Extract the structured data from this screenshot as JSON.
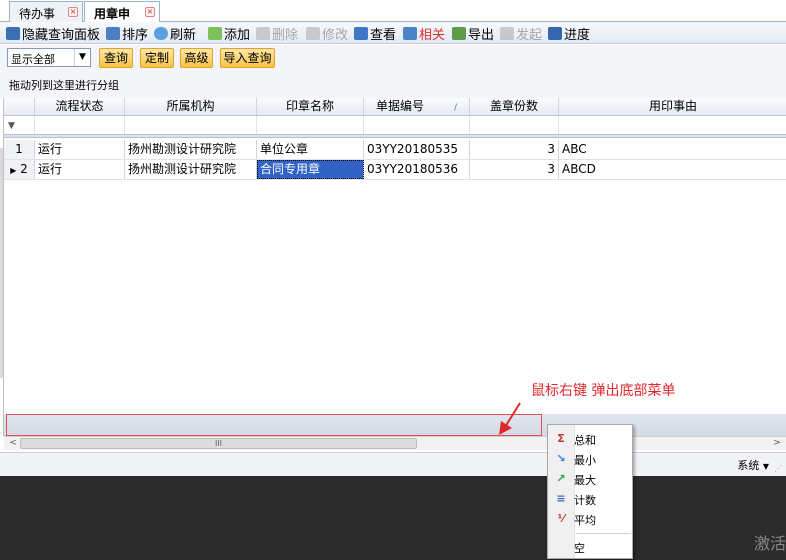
{
  "tabs": [
    {
      "label": "待办事务",
      "active": false
    },
    {
      "label": "用章申请",
      "active": true
    }
  ],
  "toolbar": {
    "hide_panel": "隐藏查询面板",
    "sort": "排序",
    "refresh": "刷新",
    "add": "添加",
    "delete": "删除",
    "edit": "修改",
    "view": "查看",
    "related": "相关",
    "export": "导出",
    "launch": "发起",
    "progress": "进度"
  },
  "filter": {
    "select_value": "显示全部",
    "query": "查询",
    "customize": "定制",
    "advanced": "高级",
    "import_query": "导入查询"
  },
  "group_hint": "拖动列到这里进行分组",
  "grid": {
    "columns": [
      "流程状态",
      "所属机构",
      "印章名称",
      "单据编号",
      "盖章份数",
      "用印事由"
    ],
    "rows": [
      {
        "index": "1",
        "status": "运行",
        "org": "扬州勘测设计研究院",
        "seal": "单位公章",
        "doc_no": "03YY20180535",
        "copies": "3",
        "reason": "ABC"
      },
      {
        "index": "2",
        "status": "运行",
        "org": "扬州勘测设计研究院",
        "seal": "合同专用章",
        "doc_no": "03YY20180536",
        "copies": "3",
        "reason": "ABCD"
      }
    ]
  },
  "annotation": "鼠标右键  弹出底部菜单",
  "scrollbar_thumb": "III",
  "status": {
    "system": "系统"
  },
  "context_menu": {
    "items": [
      {
        "label": "总和",
        "icon": "sigma-icon"
      },
      {
        "label": "最小",
        "icon": "min-icon"
      },
      {
        "label": "最大",
        "icon": "max-icon"
      },
      {
        "label": "计数",
        "icon": "count-icon"
      },
      {
        "label": "平均",
        "icon": "average-icon"
      }
    ],
    "none_label": "空"
  },
  "watermark": "激活",
  "colors": {
    "accent": "#3163c6",
    "button": "#f6c244",
    "annotation": "#e2282b"
  }
}
